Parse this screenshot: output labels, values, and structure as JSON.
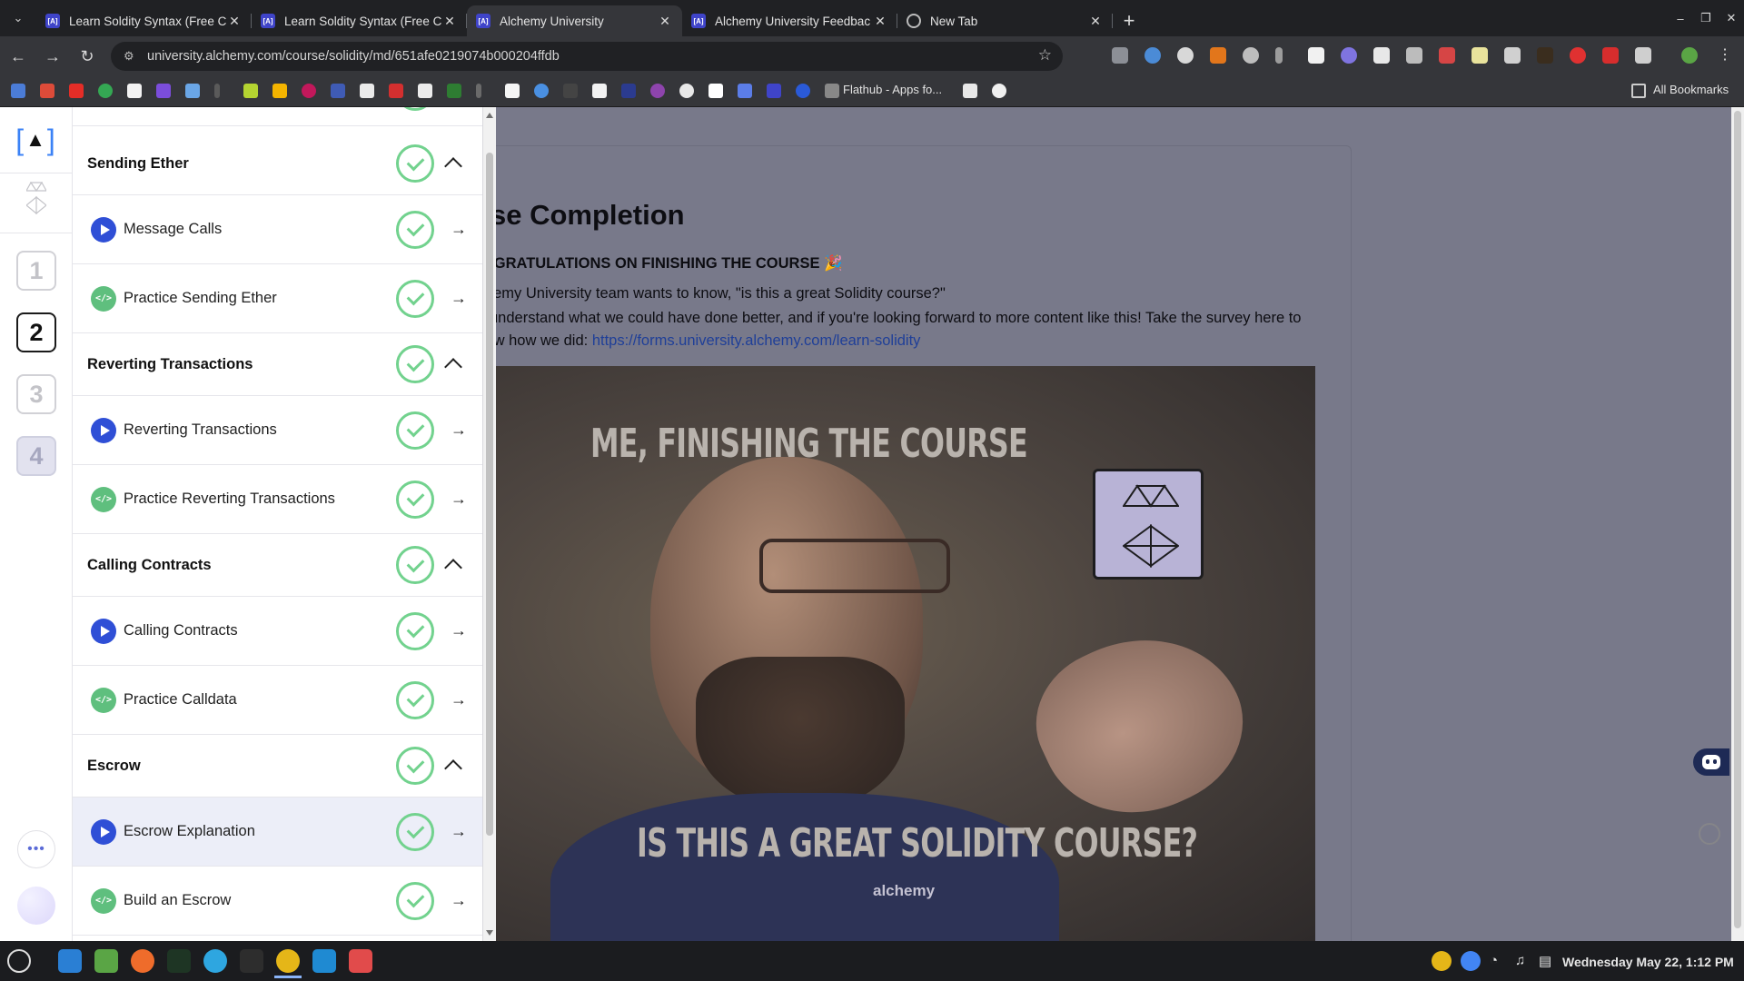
{
  "browser": {
    "tabs": [
      {
        "title": "Learn Soldity Syntax (Free C",
        "active": false,
        "icon": "alchemy-favicon"
      },
      {
        "title": "Learn Soldity Syntax (Free C",
        "active": false,
        "icon": "alchemy-favicon"
      },
      {
        "title": "Alchemy University",
        "active": true,
        "icon": "alchemy-favicon"
      },
      {
        "title": "Alchemy University Feedbac",
        "active": false,
        "icon": "alchemy-favicon"
      },
      {
        "title": "New Tab",
        "active": false,
        "icon": "chrome-globe-icon"
      }
    ],
    "url": "university.alchemy.com/course/solidity/md/651afe0219074b000204ffdb",
    "bookmarks": {
      "flathub_label": "Flathub - Apps fo...",
      "all_bookmarks_label": "All Bookmarks"
    }
  },
  "rail": {
    "steps": [
      "1",
      "2",
      "3",
      "4"
    ],
    "current_step": "2"
  },
  "lessons": [
    {
      "type": "section",
      "label": "Sending Ether",
      "complete": true
    },
    {
      "type": "video",
      "label": "Message Calls",
      "complete": true
    },
    {
      "type": "code",
      "label": "Practice Sending Ether",
      "complete": true
    },
    {
      "type": "section",
      "label": "Reverting Transactions",
      "complete": true
    },
    {
      "type": "video",
      "label": "Reverting Transactions",
      "complete": true
    },
    {
      "type": "code",
      "label": "Practice Reverting Transactions",
      "complete": true
    },
    {
      "type": "section",
      "label": "Calling Contracts",
      "complete": true
    },
    {
      "type": "video",
      "label": "Calling Contracts",
      "complete": true
    },
    {
      "type": "code",
      "label": "Practice Calldata",
      "complete": true
    },
    {
      "type": "section",
      "label": "Escrow",
      "complete": true
    },
    {
      "type": "video",
      "label": "Escrow Explanation",
      "complete": true,
      "active": true
    },
    {
      "type": "code",
      "label": "Build an Escrow",
      "complete": true
    }
  ],
  "content": {
    "title": "urse Completion",
    "congrats": "ONGRATULATIONS ON FINISHING THE COURSE 🎉",
    "p1": "lchemy University team wants to know, \"is this a great Solidity course?\"",
    "p2_before": "us understand what we could have done better, and if you're looking forward to more content like this! Take the survey here to know how we did: ",
    "p2_link": "https://forms.university.alchemy.com/learn-solidity",
    "meme_top": "ME, FINISHING THE COURSE",
    "meme_bottom": "IS THIS A GREAT SOLIDITY COURSE?",
    "shirt_text": "alchemy"
  },
  "taskbar": {
    "clock": "Wednesday May 22, 1:12 PM"
  },
  "colors": {
    "accent_blue": "#2f4fd6",
    "complete_green": "#72d28e",
    "code_green": "#5fbf7e",
    "overlay": "#78798a"
  }
}
